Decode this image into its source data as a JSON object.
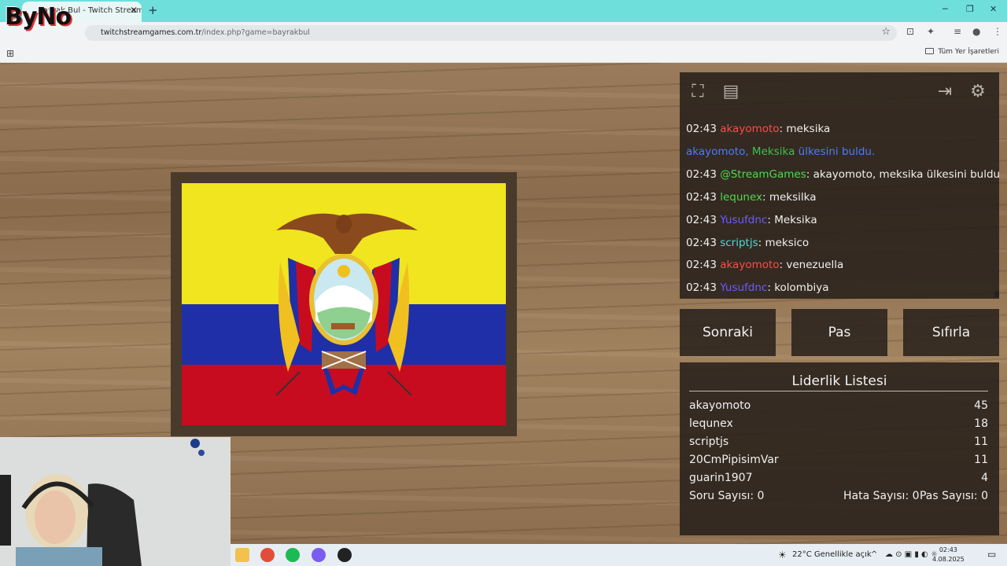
{
  "browser": {
    "tab_title": "Bayrak Bul - Twitch Stream Games",
    "url_domain": "twitchstreamgames.com.tr",
    "url_path": "/index.php?game=bayrakbul",
    "bookmarks_label": "Tüm Yer İşaretleri"
  },
  "logo_text": "ByNo",
  "chat": {
    "messages": [
      {
        "time": "02:43",
        "user": "akayomoto",
        "user_color": "#ff4b4b",
        "text": ": meksika"
      },
      {
        "time": "",
        "user": "akayomoto,",
        "user_color": "#4a7cff",
        "extra": " Meksika",
        "extra_color": "#3fc04f",
        "text": " ülkesini buldu.",
        "text_color": "#4a7cff"
      },
      {
        "time": "02:43",
        "user": "@StreamGames",
        "user_color": "#4ed94e",
        "text": ": akayomoto, meksika ülkesini buldu."
      },
      {
        "time": "02:43",
        "user": "lequnex",
        "user_color": "#4ed94e",
        "text": ": meksilka"
      },
      {
        "time": "02:43",
        "user": "Yusufdnc",
        "user_color": "#6a5cff",
        "text": ": Meksika"
      },
      {
        "time": "02:43",
        "user": "scriptjs",
        "user_color": "#4fd8d8",
        "text": ": meksico"
      },
      {
        "time": "02:43",
        "user": "akayomoto",
        "user_color": "#ff4b4b",
        "text": ": venezuella"
      },
      {
        "time": "02:43",
        "user": "Yusufdnc",
        "user_color": "#6a5cff",
        "text": ": kolombiya"
      }
    ]
  },
  "buttons": {
    "next": "Sonraki",
    "pass": "Pas",
    "reset": "Sıfırla"
  },
  "leaderboard": {
    "title": "Liderlik Listesi",
    "rows": [
      {
        "name": "akayomoto",
        "score": "45"
      },
      {
        "name": "lequnex",
        "score": "18"
      },
      {
        "name": "scriptjs",
        "score": "11"
      },
      {
        "name": "20CmPipisimVar",
        "score": "11"
      },
      {
        "name": "guarin1907",
        "score": "4"
      }
    ],
    "question_count": "Soru Sayısı: 0",
    "error_count": "Hata Sayısı: 0",
    "pass_count": "Pas Sayısı: 0"
  },
  "taskbar": {
    "weather": "22°C  Genellikle açık",
    "time": "02:43",
    "date": "4.08.2025"
  },
  "flag_colors": {
    "yellow": "#f0e51f",
    "blue": "#1f2fa8",
    "red": "#c80c1f"
  }
}
